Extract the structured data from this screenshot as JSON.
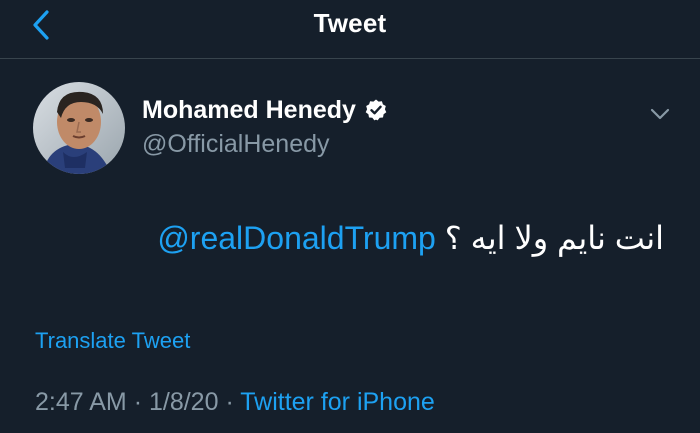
{
  "nav": {
    "title": "Tweet",
    "back_icon": "chevron-left-icon"
  },
  "author": {
    "display_name": "Mohamed Henedy",
    "handle": "@OfficialHenedy",
    "verified_icon": "verified-badge-icon",
    "avatar_icon": "user-avatar"
  },
  "more_icon": "chevron-down-icon",
  "tweet": {
    "mention": "@realDonaldTrump",
    "text_after_mention": "انت نايم ولا ايه ؟"
  },
  "translate_label": "Translate Tweet",
  "meta": {
    "time": "2:47 AM",
    "separator": "·",
    "date": "1/8/20",
    "source": "Twitter for iPhone"
  },
  "colors": {
    "background": "#151f2b",
    "accent": "#1da1f2",
    "secondary_text": "#8899a6",
    "divider": "#38444d"
  }
}
